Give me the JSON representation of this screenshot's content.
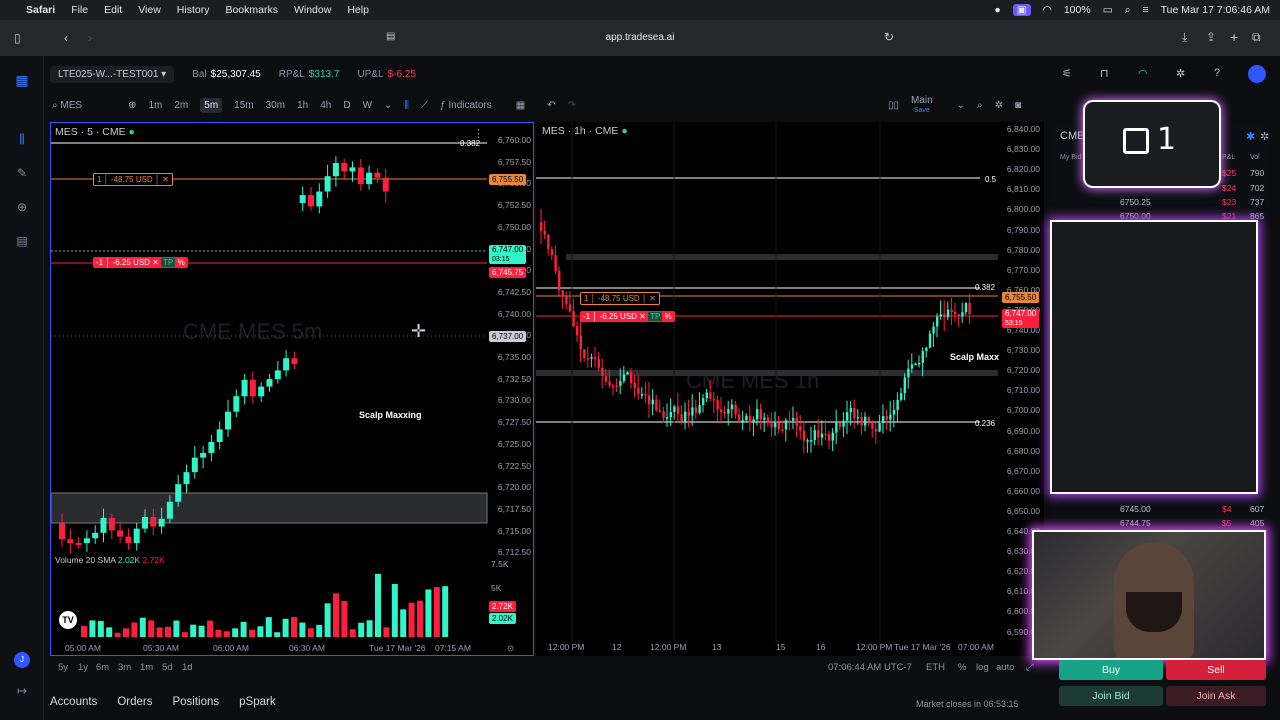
{
  "menubar": {
    "app": "Safari",
    "items": [
      "File",
      "Edit",
      "View",
      "History",
      "Bookmarks",
      "Window",
      "Help"
    ],
    "battery": "100%",
    "datetime": "Tue Mar 17  7:06:46 AM"
  },
  "browser": {
    "url": "app.tradesea.ai"
  },
  "account": {
    "name": "LTE025-W...-TEST001",
    "bal_label": "Bal",
    "bal_value": "$25,307.45",
    "rpl_label": "RP&L",
    "rpl_value": "$313.7",
    "upl_label": "UP&L",
    "upl_value": "$-6.25"
  },
  "toolbar": {
    "symbol": "MES",
    "timeframes": [
      "1m",
      "2m",
      "5m",
      "15m",
      "30m",
      "1h",
      "4h",
      "D",
      "W"
    ],
    "active_tf": "5m",
    "indicators": "Indicators",
    "layout_name": "Main",
    "layout_sub": "Save"
  },
  "left_chart": {
    "title": "MES · 5 · CME",
    "watermark": "CME MES 5m",
    "annotation": "Scalp Maxxing",
    "order_top": {
      "qty": "1",
      "pnl": "-48.75 USD",
      "price": "6,755.50"
    },
    "order_mid": {
      "qty": "-1",
      "pnl": "-6.25 USD",
      "tp": "TP",
      "pct": "%",
      "price": "6,747.00",
      "sub": "03:15",
      "price2": "6,745.75"
    },
    "crosshair_price": "6,737.00",
    "fib": "0.382",
    "y_ticks": [
      "6,760.00",
      "6,757.50",
      "6,755.00",
      "6,752.50",
      "6,750.00",
      "6,747.50",
      "6,745.00",
      "6,742.50",
      "6,740.00",
      "6,737.50",
      "6,735.00",
      "6,732.50",
      "6,730.00",
      "6,727.50",
      "6,725.00",
      "6,722.50",
      "6,720.00",
      "6,717.50",
      "6,715.00",
      "6,712.50"
    ],
    "x_ticks": [
      "05:00 AM",
      "05:30 AM",
      "06:00 AM",
      "06:30 AM",
      "Tue 17 Mar '26",
      "07:15 AM"
    ],
    "volume_label": "Volume 20 SMA",
    "volume_v1": "2.02K",
    "volume_v2": "2.72K",
    "vol_ticks": [
      "7.5K",
      "5K"
    ],
    "vol_tag1": "2.72K",
    "vol_tag2": "2.02K"
  },
  "right_chart": {
    "title": "MES · 1h · CME",
    "watermark": "CME MES 1h",
    "annotation": "Scalp Maxx",
    "order_top": {
      "qty": "1",
      "pnl": "-48.75 USD",
      "price": "6,755.50"
    },
    "order_mid": {
      "qty": "-1",
      "pnl": "-6.25 USD",
      "tp": "TP",
      "pct": "%",
      "price": "6,747.00",
      "sub": "53:15"
    },
    "fib_top": "0.5",
    "fib_mid": "0.382",
    "fib_low": "0.236",
    "y_ticks": [
      "6,840.00",
      "6,830.00",
      "6,820.00",
      "6,810.00",
      "6,800.00",
      "6,790.00",
      "6,780.00",
      "6,770.00",
      "6,760.00",
      "6,750.00",
      "6,740.00",
      "6,730.00",
      "6,720.00",
      "6,710.00",
      "6,700.00",
      "6,690.00",
      "6,680.00",
      "6,670.00",
      "6,660.00",
      "6,650.00",
      "6,640.00",
      "6,630.00",
      "6,620.00",
      "6,610.00",
      "6,600.00",
      "6,590.00"
    ],
    "x_ticks": [
      "12:00 PM",
      "12",
      "12:00 PM",
      "13",
      "15",
      "16",
      "12:00 PM",
      "Tue 17 Mar '26",
      "07:00 AM"
    ]
  },
  "bottom": {
    "ranges": [
      "5y",
      "1y",
      "6m",
      "3m",
      "1m",
      "5d",
      "1d"
    ],
    "time": "07:06:44 AM UTC-7",
    "session": "ETH",
    "pct": "%",
    "log": "log",
    "auto": "auto",
    "market": "Market closes in 06:53:15",
    "tabs": [
      "Accounts",
      "Orders",
      "Positions",
      "pSpark"
    ]
  },
  "dom": {
    "symbol": "CME",
    "lock_count": "1",
    "cols": [
      "My Bid",
      "P&L",
      "Vol"
    ],
    "rows_top": [
      {
        "price": "",
        "pnl": "$25",
        "vol": "790"
      },
      {
        "price": "",
        "pnl": "$24",
        "vol": "702"
      },
      {
        "price": "6750.25",
        "pnl": "$23",
        "vol": "737"
      },
      {
        "price": "6750.00",
        "pnl": "$21",
        "vol": "865"
      }
    ],
    "rows_bottom": [
      {
        "price": "6745.00",
        "pnl": "$4",
        "vol": "607"
      },
      {
        "price": "6744.75",
        "pnl": "$5",
        "vol": "405"
      }
    ],
    "buy": "Buy",
    "sell": "Sell",
    "join_bid": "Join Bid",
    "join_ask": "Join Ask"
  },
  "colors": {
    "up": "#2ff5c8",
    "down": "#ff1f3d",
    "accent": "#2f57ff"
  }
}
